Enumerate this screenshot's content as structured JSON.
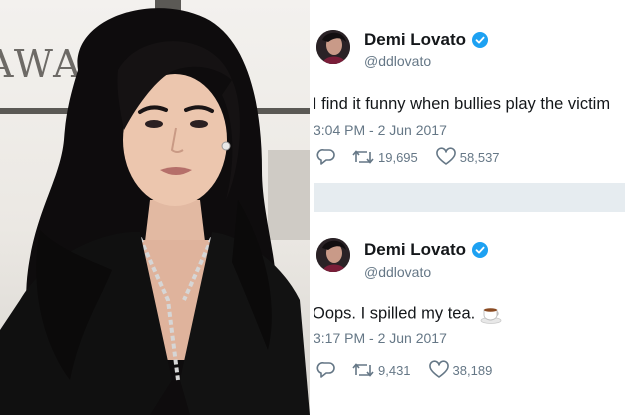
{
  "photo": {
    "backdrop_text": "AWARDS"
  },
  "tweets": [
    {
      "display_name": "Demi Lovato",
      "handle": "@ddlovato",
      "text": "I find it funny when bullies play the victim",
      "timestamp": "3:04 PM - 2 Jun 2017",
      "retweets": "19,695",
      "likes": "58,537"
    },
    {
      "display_name": "Demi Lovato",
      "handle": "@ddlovato",
      "text": "Oops. I spilled my tea.",
      "timestamp": "3:17 PM - 2 Jun 2017",
      "retweets": "9,431",
      "likes": "38,189"
    }
  ],
  "icons": {
    "verified": "verified-badge-icon",
    "reply": "reply-icon",
    "retweet": "retweet-icon",
    "like": "heart-icon",
    "tea": "tea-cup-emoji"
  },
  "colors": {
    "verified_blue": "#1da1f2",
    "text_primary": "#14171a",
    "text_secondary": "#657786",
    "feed_background": "#e6ecf0"
  }
}
